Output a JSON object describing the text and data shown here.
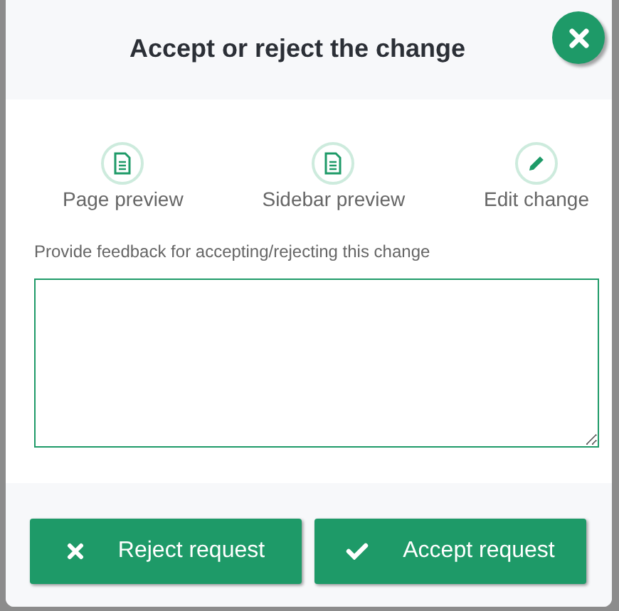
{
  "dialog": {
    "title": "Accept or reject the change"
  },
  "actions": [
    {
      "label": "Page preview",
      "kind": "document"
    },
    {
      "label": "Sidebar preview",
      "kind": "document"
    },
    {
      "label": "Edit change",
      "kind": "pencil"
    }
  ],
  "feedback": {
    "label": "Provide feedback for accepting/rejecting this change"
  },
  "buttons": [
    {
      "label": "Reject request",
      "kind": "reject"
    },
    {
      "label": "Accept request",
      "kind": "accept"
    }
  ]
}
